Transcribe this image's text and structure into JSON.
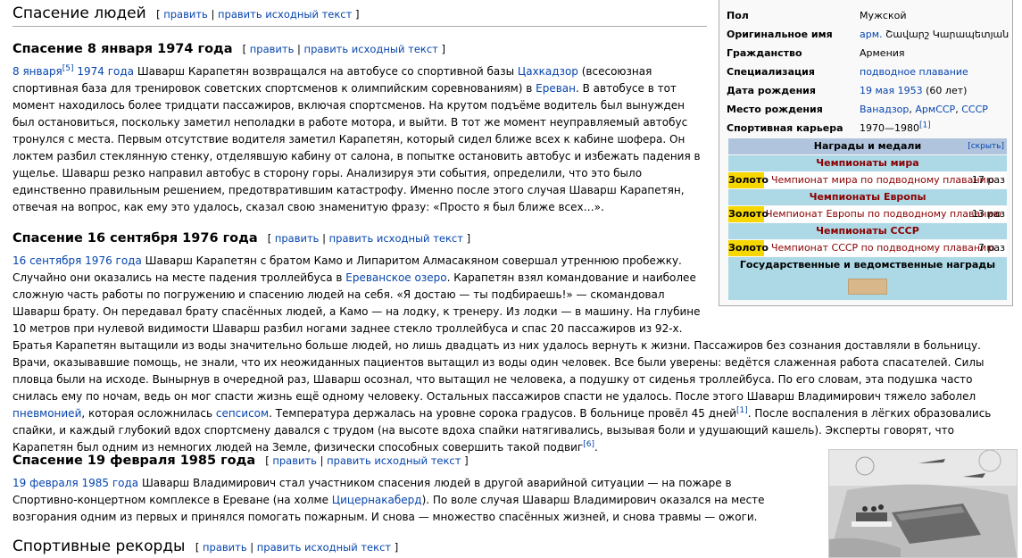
{
  "heading": {
    "title": "Спасение людей",
    "edit1": "править",
    "sep": "|",
    "edit2": "править исходный текст"
  },
  "sections": {
    "s1": {
      "title": "Спасение 8 января 1974 года",
      "link1": "8 января",
      "ref1": "[5]",
      "link2": "1974 года",
      "t1": " Шаварш Карапетян возвращался на автобусе со спортивной базы ",
      "link3": "Цахкадзор",
      "t2": " (всесоюзная спортивная база для тренировок советских спортсменов к олимпийским соревнованиям) в ",
      "link4": "Ереван",
      "t3": ". В автобусе в тот момент находилось более тридцати пассажиров, включая спортсменов. На крутом подъёме водитель был вынужден был остановиться, поскольку заметил неполадки в работе мотора, и выйти. В тот же момент неуправляемый автобус тронулся с места. Первым отсутствие водителя заметил Карапетян, который сидел ближе всех к кабине шофера. Он локтем разбил стеклянную стенку, отделявшую кабину от салона, в попытке остановить автобус и избежать падения в ущелье. Шаварш резко направил автобус в сторону горы. Анализируя эти события, определили, что это было единственно правильным решением, предотвратившим катастрофу. Именно после этого случая Шаварш Карапетян, отвечая на вопрос, как ему это удалось, сказал свою знаменитую фразу: «Просто я был ближе всех…»."
    },
    "s2": {
      "title": "Спасение 16 сентября 1976 года",
      "link1": "16 сентября 1976 года",
      "t1": " Шаварш Карапетян с братом Камо и Липаритом Алмасакяном совершал утреннюю пробежку. Случайно они оказались на месте падения троллейбуса в ",
      "link2": "Ереванское озеро",
      "t2": ". Карапетян взял командование и наиболее сложную часть работы по погружению и спасению людей на себя. «Я достаю — ты подбираешь!» — скомандовал Шаварш брату. Он передавал брату спасённых людей, а Камо — на лодку, к тренеру. Из лодки — в машину. На глубине 10 метров при нулевой видимости Шаварш разбил ногами заднее стекло троллейбуса и спас 20 пассажиров из 92-х. Братья Карапетян вытащили из воды значительно больше людей, но лишь двадцать из них удалось вернуть к жизни. Пассажиров без сознания доставляли в больницу. Врачи, оказывавшие помощь, не знали, что их неожиданных пациентов вытащил из воды один человек. Все были уверены: ведётся слаженная работа спасателей. Силы пловца были на исходе. Вынырнув в очередной раз, Шаварш осознал, что вытащил не человека, а подушку от сиденья троллейбуса. По его словам, эта подушка часто снилась ему по ночам, ведь он мог спасти жизнь ещё одному человеку. Остальных пассажиров спасти не удалось. После этого Шаварш Владимирович тяжело заболел ",
      "link3": "пневмонией",
      "t3": ", которая осложнилась ",
      "link4": "сепсисом",
      "t4": ". Температура держалась на уровне сорока градусов. В больнице провёл 45 дней",
      "ref1": "[1]",
      "t5": ". После воспаления в лёгких образовались спайки, и каждый глубокий вдох спортсмену давался с трудом (на высоте вдоха спайки натягивались, вызывая боли и удушающий кашель). Эксперты говорят, что Карапетян был одним из немногих людей на Земле, физически способных совершить такой подвиг",
      "ref2": "[6]",
      "t6": "."
    },
    "s3": {
      "title": "Спасение 19 февраля 1985 года",
      "link1": "19 февраля 1985 года",
      "t1": " Шаварш Владимирович стал участником спасения людей в другой аварийной ситуации — на пожаре в Спортивно-концертном комплексе в Ереване (на холме ",
      "link2": "Цицернакаберд",
      "t2": "). По воле случая Шаварш Владимирович оказался на месте возгорания одним из первых и принялся помогать пожарным. И снова — множество спасённых жизней, и снова травмы — ожоги."
    },
    "s4": {
      "title": "Спортивные рекорды"
    }
  },
  "infobox": {
    "rows": [
      {
        "k": "Пол",
        "v": "Мужской"
      },
      {
        "k": "Оригинальное имя",
        "v1": "арм.",
        "v2": " Շավարշ Կարապետյան"
      },
      {
        "k": "Гражданство",
        "v": "Армения"
      },
      {
        "k": "Специализация",
        "v": "подводное плавание"
      },
      {
        "k": "Дата рождения",
        "v1": "19 мая 1953",
        "v2": " (60 лет)"
      },
      {
        "k": "Место рождения",
        "v1": "Ванадзор",
        "v2": ", ",
        "v3": "АрмССР",
        "v4": ", ",
        "v5": "СССР"
      },
      {
        "k": "Спортивная карьера",
        "v": "1970—1980",
        "ref": "[1]"
      }
    ],
    "awards": {
      "title": "Награды и медали",
      "hide": "[скрыть]",
      "cat1": "Чемпионаты мира",
      "line1": {
        "gold": "Золото",
        "event": "Чемпионат мира по подводному плаванию",
        "count": "17 раз"
      },
      "cat2": "Чемпионаты Европы",
      "line2": {
        "gold": "Золото",
        "event": "Чемпионат Европы по подводному плаванию",
        "count": "13 раз"
      },
      "cat3": "Чемпионаты СССР",
      "line3": {
        "gold": "Золото",
        "event": "Чемпионат СССР по подводному плаванию",
        "count": "7 раз"
      },
      "state": "Государственные и ведомственные награды"
    }
  }
}
